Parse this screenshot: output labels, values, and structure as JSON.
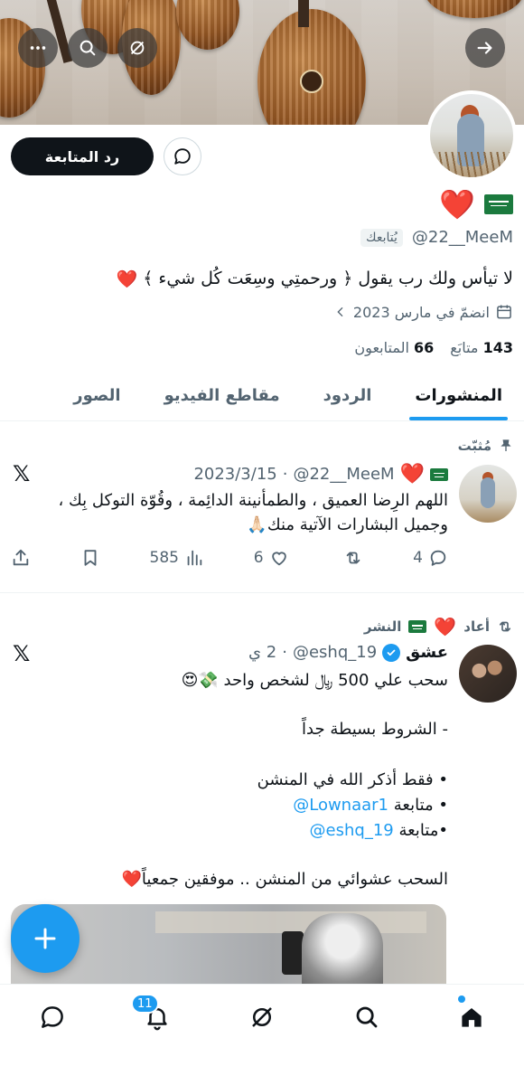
{
  "profile": {
    "handle": "@22__MeeM",
    "follows_you": "يُتابعك",
    "bio": "لا تيأس ولك رب يقول ﴿ ورحمتِي وسِعَت كُل شيء ﴾",
    "joined": "انضمّ في مارس 2023",
    "following_count": "143",
    "following_label": "متابَع",
    "followers_count": "66",
    "followers_label": "المتابعون",
    "follow_back_label": "رد المتابعة",
    "heart": "❤️"
  },
  "tabs": [
    "المنشورات",
    "الردود",
    "مقاطع الفيديو",
    "الصور"
  ],
  "post1": {
    "context": "مُثبّت",
    "handle": "@22__MeeM",
    "date": "2023/3/15",
    "text": "اللهم  الرِضا العميق ، والطمأنينة الدائِمة ، وقُوّة التوكل بِك ، وجميل البشارات الآتية منك🙏🏻",
    "replies": "4",
    "reposts": "",
    "likes": "6",
    "views": "585"
  },
  "post2": {
    "context": "أعاد",
    "context_suffix": "النشر",
    "name": "عشق",
    "handle": "@eshq_19",
    "time": "2 ي",
    "lines": [
      "سحب علي 500 ﷼ لشخص  واحد 💸😍",
      "- الشروط بسيطة جداً",
      "• فقط أذكر الله في المنشن",
      "• متابعة",
      "•متابعة",
      "السحب عشوائي من المنشن .. موفقين جمعياً❤️"
    ],
    "link1": "@Lownaar1",
    "link2": "@eshq_19"
  },
  "nav": {
    "notifications_badge": "11"
  },
  "icons": {
    "banner": [
      "back-arrow-icon",
      "grok-icon",
      "search-icon",
      "more-icon"
    ],
    "actions": [
      "reply-icon",
      "repost-icon",
      "like-icon",
      "views-icon",
      "bookmark-icon",
      "share-icon"
    ],
    "nav": [
      "home-icon",
      "search-icon",
      "grok-icon",
      "notifications-icon",
      "messages-icon"
    ]
  },
  "colors": {
    "accent": "#1d9bf0",
    "text": "#0f1419",
    "muted": "#536471",
    "heart": "#d8182e"
  }
}
